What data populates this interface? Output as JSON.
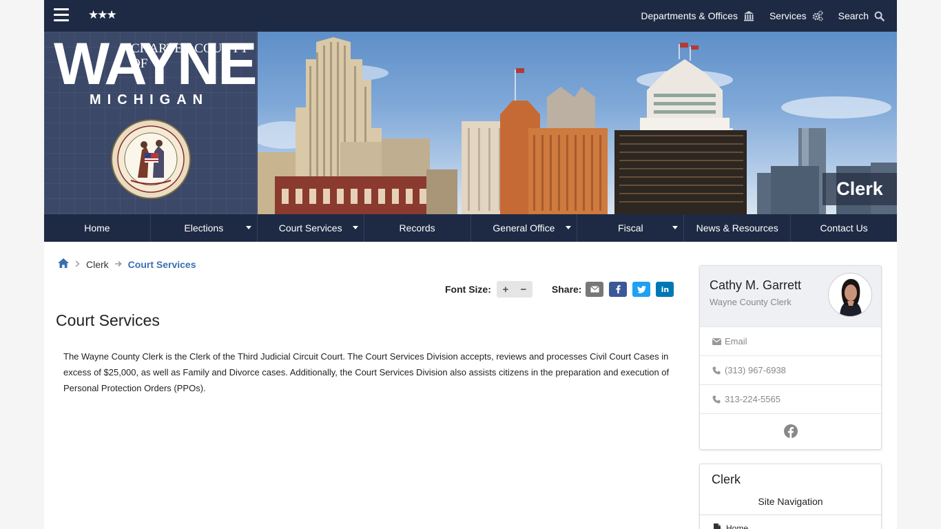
{
  "topbar": {
    "stars": "★★★",
    "links": [
      {
        "label": "Departments & Offices",
        "icon": "building-icon"
      },
      {
        "label": "Services",
        "icon": "gears-icon"
      },
      {
        "label": "Search",
        "icon": "search-icon"
      }
    ]
  },
  "banner": {
    "logo": {
      "charter": "CHARTER COUNTY OF",
      "wayne": "WAYNE",
      "michigan": "MICHIGAN"
    },
    "department": "Clerk"
  },
  "mainnav": {
    "items": [
      {
        "label": "Home",
        "dropdown": false
      },
      {
        "label": "Elections",
        "dropdown": true
      },
      {
        "label": "Court Services",
        "dropdown": true
      },
      {
        "label": "Records",
        "dropdown": false
      },
      {
        "label": "General Office",
        "dropdown": true
      },
      {
        "label": "Fiscal",
        "dropdown": true
      },
      {
        "label": "News & Resources",
        "dropdown": false
      },
      {
        "label": "Contact Us",
        "dropdown": false
      }
    ]
  },
  "breadcrumb": {
    "items": [
      "Clerk",
      "Court Services"
    ]
  },
  "tools": {
    "font_size_label": "Font Size:",
    "increase": "+",
    "decrease": "−",
    "share_label": "Share:"
  },
  "content": {
    "title": "Court Services",
    "body": "The Wayne County Clerk is the Clerk of the Third Judicial Circuit Court. The Court Services Division accepts, reviews and processes Civil Court Cases in excess of $25,000, as well as Family and Divorce cases. Additionally, the Court Services Division also assists citizens in the preparation and execution of Personal Protection Orders (PPOs)."
  },
  "contact_card": {
    "name": "Cathy M. Garrett",
    "title": "Wayne County Clerk",
    "email_label": "Email",
    "phone1": "(313) 967-6938",
    "phone2": "313-224-5565"
  },
  "nav_card": {
    "title": "Clerk",
    "subtitle": "Site Navigation",
    "first_item": "Home"
  },
  "colors": {
    "navy": "#1e2a44",
    "link_blue": "#3a6fb0",
    "facebook": "#3b5998",
    "twitter": "#1da1f2",
    "linkedin": "#0077b5"
  }
}
